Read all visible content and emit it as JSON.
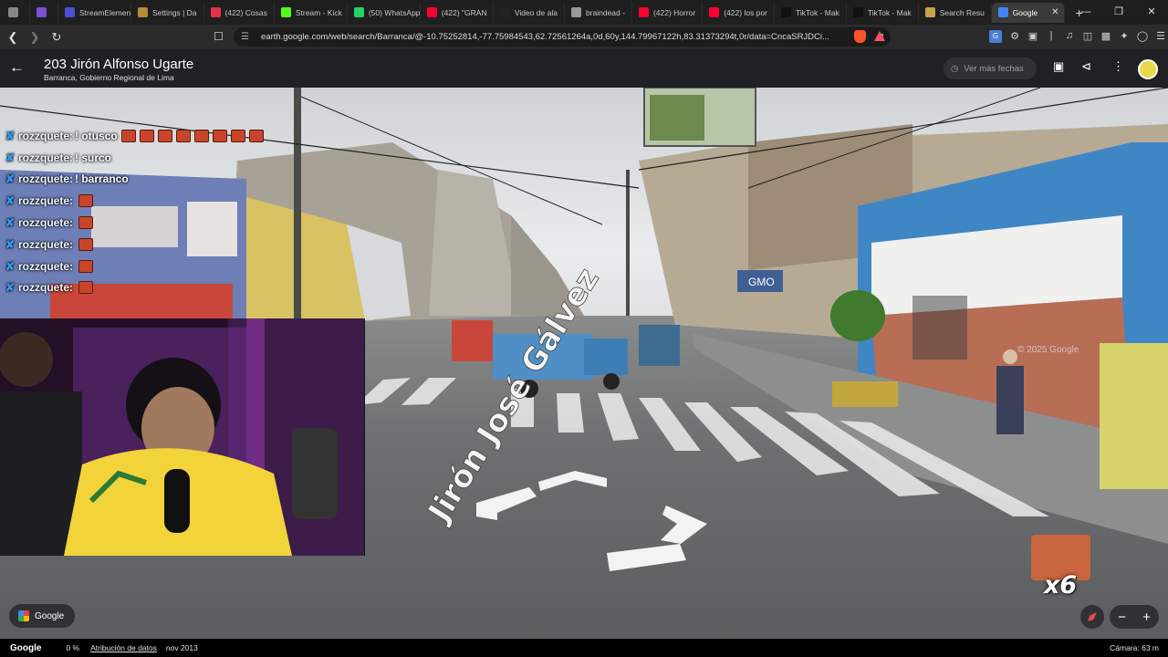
{
  "tabs": [
    {
      "label": "",
      "color": "#888"
    },
    {
      "label": "",
      "color": "#7a4fd6"
    },
    {
      "label": "StreamElements",
      "color": "#4c4fd6"
    },
    {
      "label": "Settings | Da",
      "color": "#b88a3a"
    },
    {
      "label": "(422) Cosas",
      "color": "#e2324a"
    },
    {
      "label": "Stream - Kick",
      "color": "#53fc18"
    },
    {
      "label": "(50) WhatsApp",
      "color": "#25d366"
    },
    {
      "label": "(422) \"GRAN",
      "color": "#ff0033"
    },
    {
      "label": "Video de ala",
      "color": "#222"
    },
    {
      "label": "braindead -",
      "color": "#999"
    },
    {
      "label": "(422) Horror",
      "color": "#ff0033"
    },
    {
      "label": "(422) los por",
      "color": "#ff0033"
    },
    {
      "label": "TikTok - Mak",
      "color": "#111"
    },
    {
      "label": "TikTok - Mak",
      "color": "#111"
    },
    {
      "label": "Search Resu",
      "color": "#caa24a"
    },
    {
      "label": "Google",
      "color": "#4285f4",
      "active": true
    }
  ],
  "address_bar": {
    "url": "earth.google.com/web/search/Barranca/@-10.75252814,-77.75984543,62.72561264a,0d,60y,144.79967122h,83.31373294t,0r/data=CncaSRJDCi..."
  },
  "header": {
    "title": "203 Jirón Alfonso Ugarte",
    "subtitle": "Barranca, Gobierno Regional de Lima",
    "dates_button": "Ver más fechas"
  },
  "chat": [
    {
      "user": "rozzquete:",
      "text": "! otusco",
      "emotes": 8
    },
    {
      "user": "rozzquete:",
      "text": "! surco",
      "emotes": 0
    },
    {
      "user": "rozzquete:",
      "text": "! barranco",
      "emotes": 0
    },
    {
      "user": "rozzquete:",
      "text": "",
      "emotes": 1
    },
    {
      "user": "rozzquete:",
      "text": "",
      "emotes": 1
    },
    {
      "user": "rozzquete:",
      "text": "",
      "emotes": 1
    },
    {
      "user": "rozzquete:",
      "text": "",
      "emotes": 1
    },
    {
      "user": "rozzquete:",
      "text": "",
      "emotes": 1
    }
  ],
  "street_label": "Jirón José Gálvez",
  "watermark": "© 2025 Google",
  "billboard_text": "GMO",
  "reaction": {
    "multiplier": "x6"
  },
  "google_chip": "Google",
  "bottom": {
    "logo": "Google",
    "percent": "0 %",
    "attribution": "Atribución de datos",
    "date": "nov 2013",
    "camera": "Cámara: 63 m"
  },
  "icons": {
    "back": "arrow-left-icon",
    "history": "history-icon",
    "screenshot": "screenshot-icon",
    "share": "share-icon",
    "more": "more-vert-icon"
  }
}
